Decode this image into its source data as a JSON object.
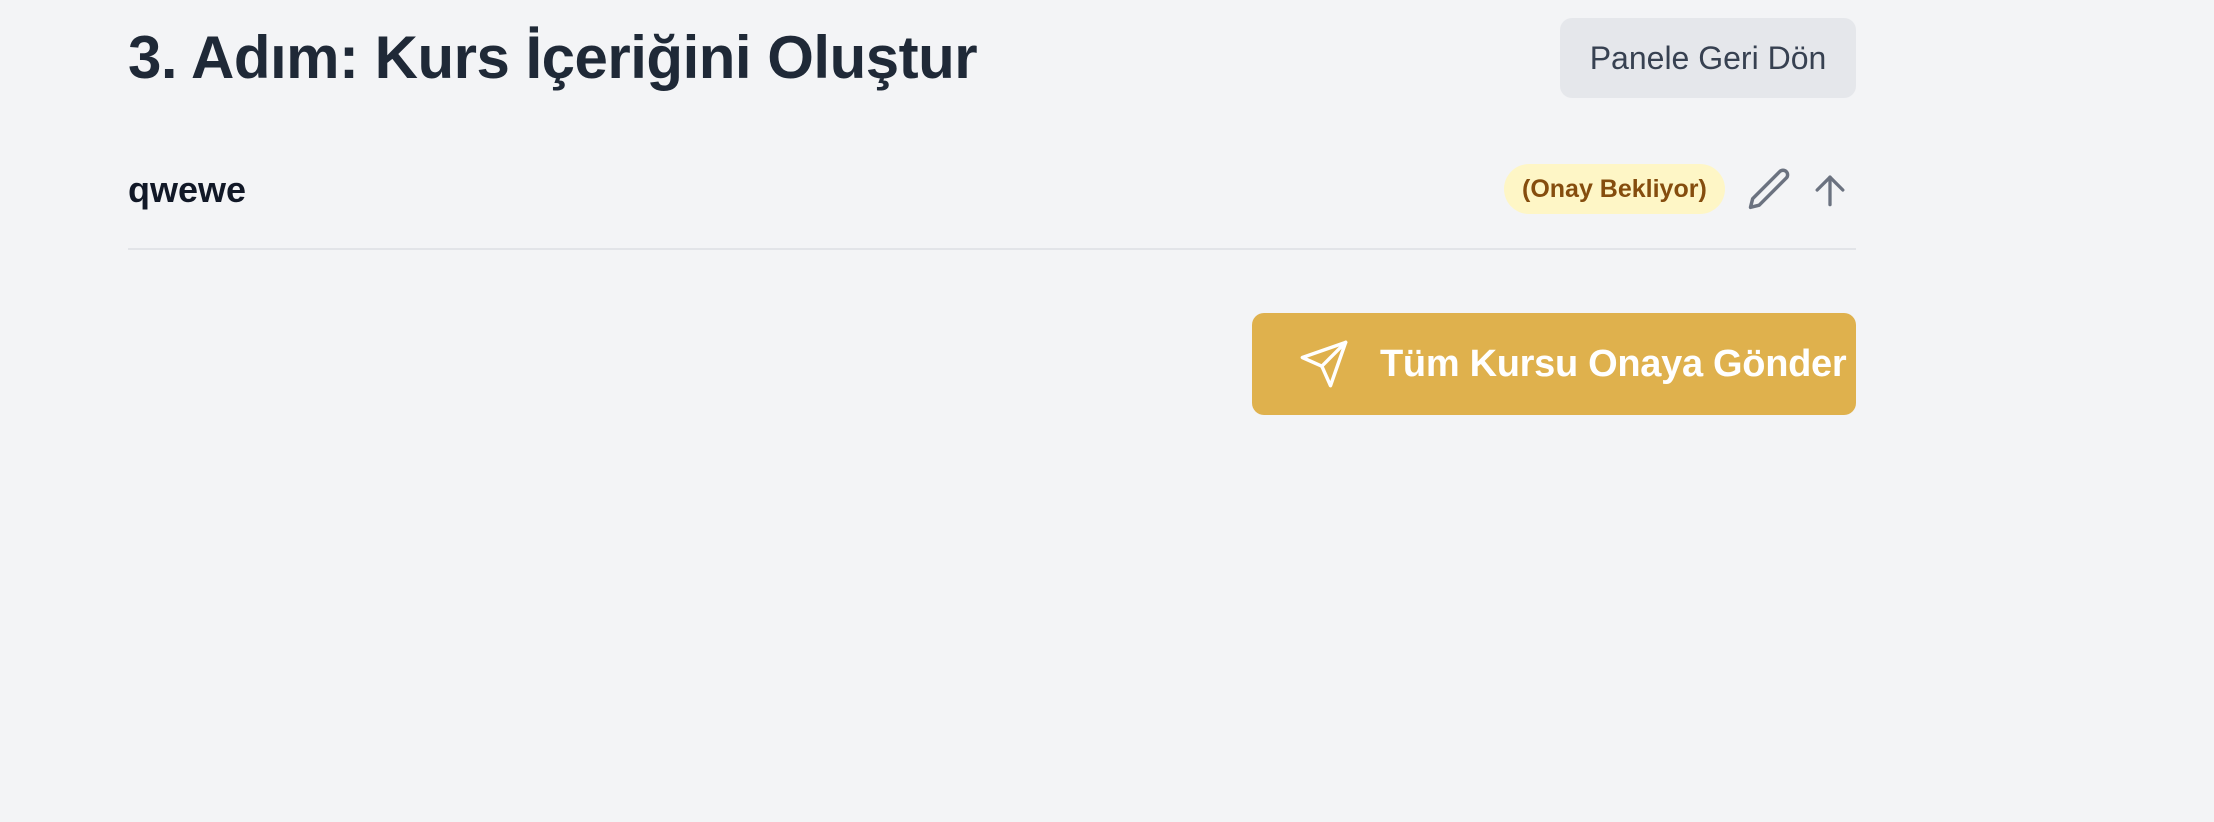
{
  "header": {
    "title": "3. Adım: Kurs İçeriğini Oluştur",
    "back_button_label": "Panele Geri Dön"
  },
  "section": {
    "title": "qwewe",
    "status": "(Onay Bekliyor)",
    "status_color": "#854d0e",
    "status_bg": "#fef6c6",
    "edit_icon": "pencil-icon",
    "move_up_icon": "arrow-up-icon"
  },
  "actions": {
    "submit_label": "Tüm Kursu Onaya Gönder",
    "submit_icon": "send-icon",
    "submit_color": "#dfb14d"
  }
}
